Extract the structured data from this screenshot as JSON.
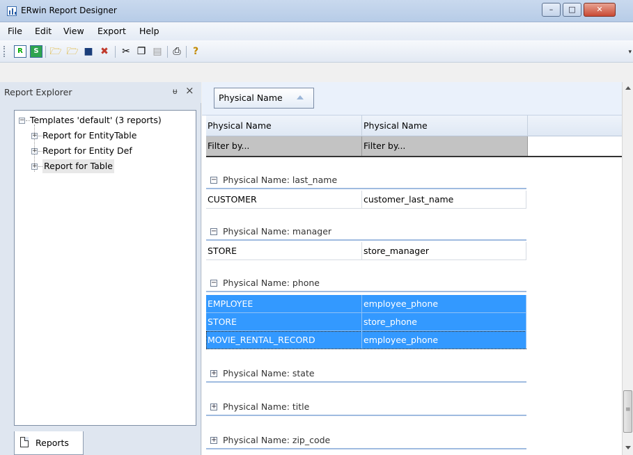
{
  "window": {
    "title": "ERwin Report Designer",
    "controls": {
      "minimize": "–",
      "maximize": "□",
      "close": "✕"
    }
  },
  "menu": [
    "File",
    "Edit",
    "View",
    "Export",
    "Help"
  ],
  "toolbar": {
    "icons": [
      "new-report-icon",
      "new-solution-icon",
      "open-folder-icon",
      "open-folder-alt-icon",
      "save-icon",
      "delete-icon",
      "cut-icon",
      "copy-icon",
      "paste-icon",
      "print-icon",
      "help-icon"
    ]
  },
  "left_panel": {
    "title": "Report Explorer",
    "pin_glyph": "ᵾ",
    "close_glyph": "×",
    "tree": {
      "root": "Templates 'default' (3 reports)",
      "children": [
        "Report for EntityTable",
        "Report for Entity Def",
        "Report for Table"
      ],
      "selected": "Report for Table"
    },
    "tab": "Reports"
  },
  "grid": {
    "group_by_chip": "Physical Name",
    "columns": [
      "Physical Name",
      "Physical Name"
    ],
    "filter_placeholder": [
      "Filter by...",
      "Filter by..."
    ],
    "groups": [
      {
        "label": "Physical Name: last_name",
        "expanded": true,
        "rows": [
          [
            "CUSTOMER",
            "customer_last_name"
          ]
        ]
      },
      {
        "label": "Physical Name: manager",
        "expanded": true,
        "rows": [
          [
            "STORE",
            "store_manager"
          ]
        ]
      },
      {
        "label": "Physical Name: phone",
        "expanded": true,
        "rows": [
          [
            "EMPLOYEE",
            "employee_phone"
          ],
          [
            "STORE",
            "store_phone"
          ],
          [
            "MOVIE_RENTAL_RECORD",
            "employee_phone"
          ]
        ],
        "selected": true
      },
      {
        "label": "Physical Name: state",
        "expanded": false,
        "rows": []
      },
      {
        "label": "Physical Name: title",
        "expanded": false,
        "rows": []
      },
      {
        "label": "Physical Name: zip_code",
        "expanded": false,
        "rows": []
      }
    ]
  },
  "colors": {
    "selection": "#3399ff",
    "group_line": "#9fbbe0",
    "title_bar": "#c9d9ee"
  }
}
